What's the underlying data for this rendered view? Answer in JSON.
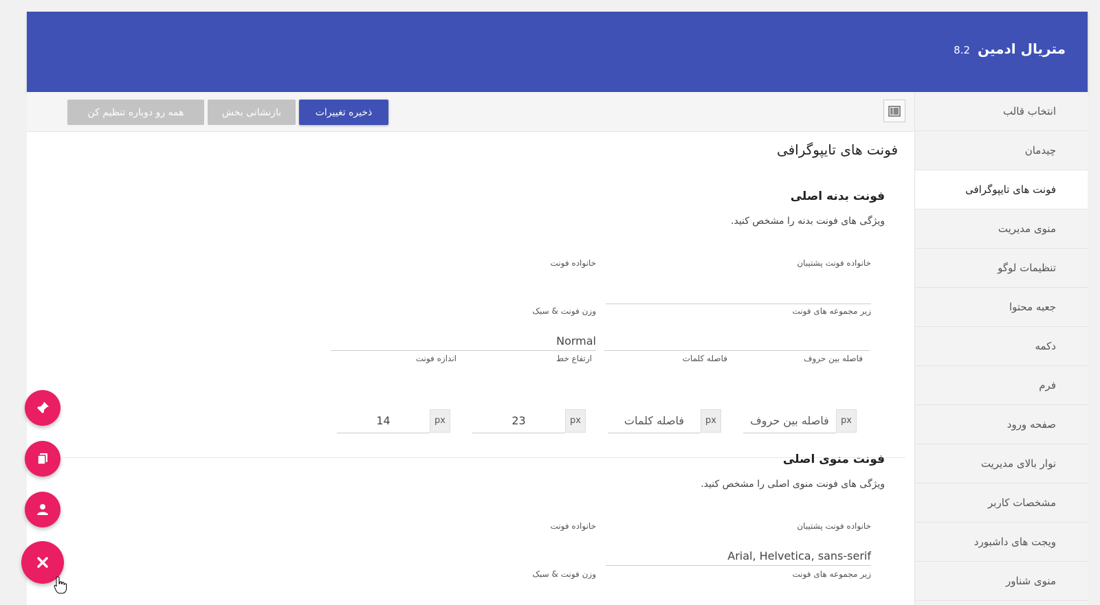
{
  "header": {
    "title": "متریال ادمین",
    "version": "8.2"
  },
  "toolbar": {
    "save_label": "ذخیره تغییرات",
    "reset_section_label": "بازنشانی بخش",
    "reset_all_label": "همه رو دوباره تنظیم کن"
  },
  "sidebar": {
    "items": [
      {
        "label": "انتخاب قالب"
      },
      {
        "label": "چیدمان"
      },
      {
        "label": "فونت های تایپوگرافی"
      },
      {
        "label": "منوی مدیریت"
      },
      {
        "label": "تنظیمات لوگو"
      },
      {
        "label": "جعبه محتوا"
      },
      {
        "label": "دکمه"
      },
      {
        "label": "فرم"
      },
      {
        "label": "صفحه ورود"
      },
      {
        "label": "نوار بالای مدیریت"
      },
      {
        "label": "مشخصات کاربر"
      },
      {
        "label": "ویجت های داشبورد"
      },
      {
        "label": "منوی شناور"
      }
    ],
    "active_index": 2
  },
  "main": {
    "section_title": "فونت های تایپوگرافی",
    "body_font": {
      "title": "فونت بدنه اصلی",
      "description": "ویژگی های فونت بدنه را مشخص کنید.",
      "backup_family_label": "خانواده فونت پشتیبان",
      "backup_family_value": "",
      "family_label": "خانواده فونت",
      "subset_label": "زیر مجموعه های فونت",
      "subset_value": "",
      "weight_label": "وزن فونت & سبک",
      "weight_value": "Normal",
      "letter_spacing_label": "فاصله بین حروف",
      "letter_spacing_placeholder": "فاصله بین حروف",
      "word_spacing_label": "فاصله کلمات",
      "word_spacing_placeholder": "فاصله کلمات",
      "line_height_label": "ارتفاع خط",
      "line_height_value": "23",
      "font_size_label": "اندازه فونت",
      "font_size_value": "14",
      "unit": "px"
    },
    "menu_font": {
      "title": "فونت منوی اصلی",
      "description": "ویژگی های فونت منوی اصلی را مشخص کنید.",
      "backup_family_label": "خانواده فونت پشتیبان",
      "backup_family_value": "Arial, Helvetica, sans-serif",
      "family_label": "خانواده فونت",
      "subset_label": "زیر مجموعه های فونت",
      "weight_label": "وزن فونت & سبک"
    }
  },
  "fab": {
    "icons": [
      "pin-icon",
      "copy-icon",
      "user-icon",
      "close-icon"
    ]
  },
  "colors": {
    "primary": "#3f51b5",
    "fab": "#e91e63",
    "button_disabled": "#c3c3c3"
  }
}
